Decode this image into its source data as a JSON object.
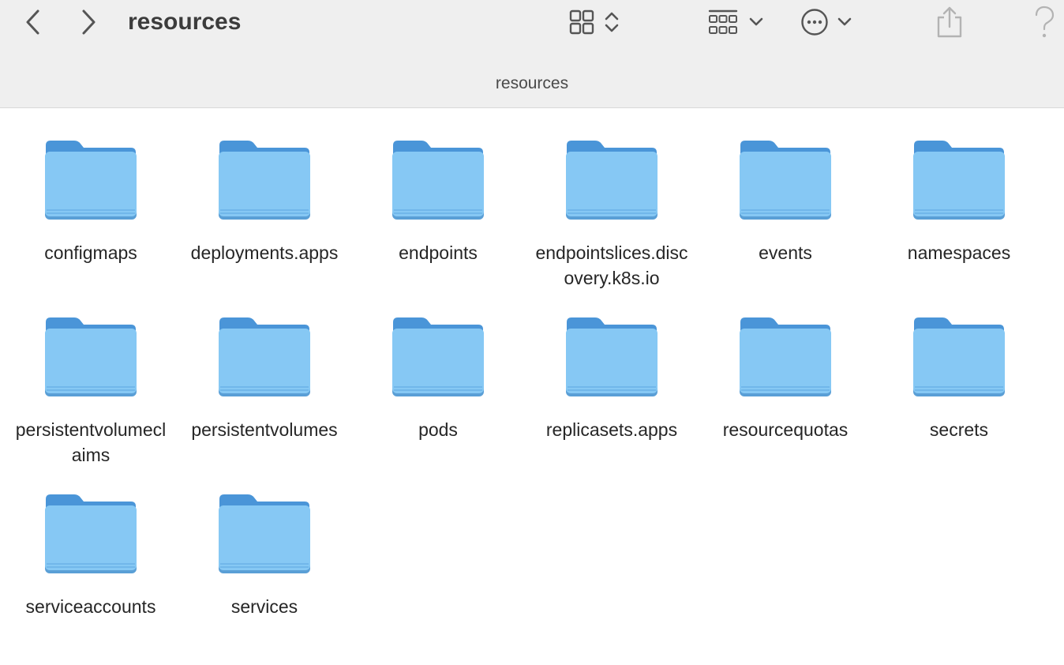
{
  "window": {
    "title": "resources",
    "path_title": "resources"
  },
  "toolbar": {
    "back_icon": "chevron-left-icon",
    "forward_icon": "chevron-right-icon",
    "view_icon": "icon-grid-view-icon",
    "group_icon": "group-by-icon",
    "action_icon": "ellipsis-circle-icon",
    "share_icon": "share-icon",
    "help_icon": "help-icon"
  },
  "colors": {
    "toolbar_bg": "#efefef",
    "folder_front": "#86c8f4",
    "folder_back": "#4a95d8",
    "text": "#262626"
  },
  "files": [
    {
      "name": "configmaps",
      "type": "folder"
    },
    {
      "name": "deployments.apps",
      "type": "folder"
    },
    {
      "name": "endpoints",
      "type": "folder"
    },
    {
      "name": "endpointslices.discovery.k8s.io",
      "type": "folder"
    },
    {
      "name": "events",
      "type": "folder"
    },
    {
      "name": "namespaces",
      "type": "folder"
    },
    {
      "name": "persistentvolumeclaims",
      "type": "folder"
    },
    {
      "name": "persistentvolumes",
      "type": "folder"
    },
    {
      "name": "pods",
      "type": "folder"
    },
    {
      "name": "replicasets.apps",
      "type": "folder"
    },
    {
      "name": "resourcequotas",
      "type": "folder"
    },
    {
      "name": "secrets",
      "type": "folder"
    },
    {
      "name": "serviceaccounts",
      "type": "folder"
    },
    {
      "name": "services",
      "type": "folder"
    }
  ]
}
